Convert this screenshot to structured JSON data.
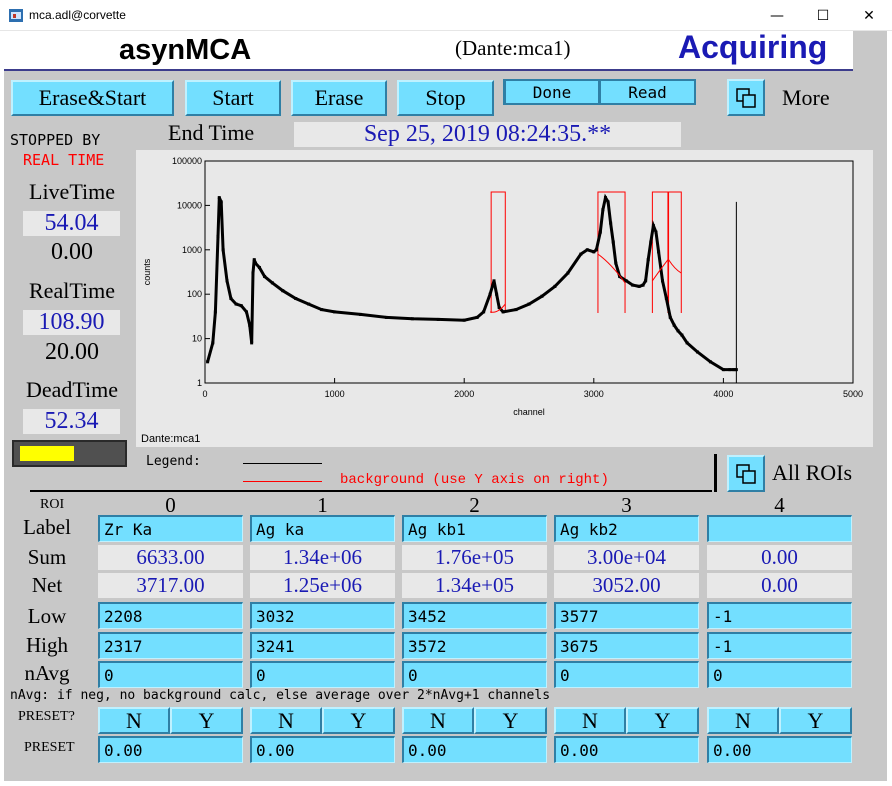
{
  "window": {
    "title": "mca.adl@corvette",
    "minimize": "—",
    "maximize": "☐",
    "close": "✕"
  },
  "header": {
    "app": "asynMCA",
    "device": "(Dante:mca1)",
    "status": "Acquiring"
  },
  "buttons": {
    "erase_start": "Erase&Start",
    "start": "Start",
    "erase": "Erase",
    "stop": "Stop",
    "more": "More",
    "all_rois": "All ROIs"
  },
  "indicators": {
    "done": "Done",
    "read": "Read"
  },
  "stopped": {
    "line1": "STOPPED BY",
    "line2": "REAL TIME"
  },
  "end_time": {
    "label": "End Time",
    "value": "Sep 25, 2019 08:24:35.**"
  },
  "live_time": {
    "label": "LiveTime",
    "value": "54.04",
    "preset": "0.00"
  },
  "real_time": {
    "label": "RealTime",
    "value": "108.90",
    "preset": "20.00"
  },
  "dead_time": {
    "label": "DeadTime",
    "value": "52.34",
    "bar_fraction": 0.5234
  },
  "colors": {
    "accent_button": "#73dfff",
    "status_blue": "#1a1ab4",
    "background_curve": "#ff0000",
    "dead_bar": "#ffff00"
  },
  "chart_data": {
    "type": "line",
    "xlabel": "channel",
    "ylabel": "counts",
    "xlim": [
      0,
      5000
    ],
    "ylim": [
      1,
      100000
    ],
    "yscale": "log",
    "x_ticks": [
      "0",
      "1000",
      "2000",
      "3000",
      "4000",
      "5000"
    ],
    "y_ticks": [
      "1",
      "10",
      "100",
      "1000",
      "10000",
      "100000"
    ],
    "footer": "Dante:mca1",
    "series": [
      {
        "name": "",
        "color": "#000000",
        "x": [
          20,
          60,
          80,
          100,
          110,
          125,
          140,
          170,
          200,
          240,
          280,
          320,
          345,
          360,
          370,
          380,
          390,
          420,
          460,
          520,
          600,
          700,
          800,
          900,
          1000,
          1200,
          1400,
          1600,
          1800,
          2000,
          2100,
          2150,
          2200,
          2230,
          2250,
          2270,
          2300,
          2400,
          2500,
          2600,
          2700,
          2800,
          2900,
          2950,
          3000,
          3020,
          3050,
          3070,
          3090,
          3110,
          3130,
          3150,
          3170,
          3200,
          3250,
          3300,
          3350,
          3380,
          3400,
          3420,
          3440,
          3460,
          3480,
          3500,
          3530,
          3560,
          3590,
          3620,
          3650,
          3680,
          3720,
          3800,
          3900,
          4000,
          4050,
          4080,
          4100
        ],
        "y": [
          3,
          8,
          40,
          2000,
          15000,
          12000,
          1000,
          200,
          80,
          60,
          55,
          40,
          20,
          8,
          300,
          600,
          500,
          400,
          250,
          180,
          120,
          80,
          60,
          45,
          40,
          35,
          30,
          28,
          27,
          26,
          30,
          40,
          100,
          200,
          100,
          50,
          40,
          45,
          60,
          90,
          150,
          300,
          800,
          1000,
          900,
          1000,
          2500,
          8000,
          15000,
          12000,
          4000,
          1500,
          500,
          250,
          200,
          160,
          150,
          160,
          200,
          600,
          1500,
          3500,
          2500,
          900,
          200,
          80,
          30,
          20,
          15,
          12,
          8,
          5,
          3,
          2,
          2,
          2,
          2
        ]
      },
      {
        "name": "background (use Y axis on right)",
        "color": "#ff0000",
        "x": [
          2200,
          2317,
          3032,
          3241,
          3452,
          3572,
          3577,
          3675
        ],
        "y": [
          40,
          60,
          800,
          180,
          200,
          600,
          600,
          300
        ]
      }
    ],
    "roi_markers": [
      2208,
      2317,
      3032,
      3241,
      3452,
      3572,
      3577,
      3675
    ],
    "legend": {
      "label": "Legend:",
      "entries": [
        "",
        "background (use Y axis on right)"
      ]
    }
  },
  "roi_table": {
    "header_label": "ROI",
    "row_labels": {
      "label": "Label",
      "sum": "Sum",
      "net": "Net",
      "low": "Low",
      "high": "High",
      "navg": "nAvg"
    },
    "columns": [
      {
        "index": "0",
        "label": "Zr Ka",
        "sum": "6633.00",
        "net": "3717.00",
        "low": "2208",
        "high": "2317",
        "navg": "0",
        "preset": "0.00"
      },
      {
        "index": "1",
        "label": "Ag ka",
        "sum": "1.34e+06",
        "net": "1.25e+06",
        "low": "3032",
        "high": "3241",
        "navg": "0",
        "preset": "0.00"
      },
      {
        "index": "2",
        "label": "Ag kb1",
        "sum": "1.76e+05",
        "net": "1.34e+05",
        "low": "3452",
        "high": "3572",
        "navg": "0",
        "preset": "0.00"
      },
      {
        "index": "3",
        "label": "Ag kb2",
        "sum": "3.00e+04",
        "net": "3052.00",
        "low": "3577",
        "high": "3675",
        "navg": "0",
        "preset": "0.00"
      },
      {
        "index": "4",
        "label": "",
        "sum": "0.00",
        "net": "0.00",
        "low": "-1",
        "high": "-1",
        "navg": "0",
        "preset": "0.00"
      }
    ],
    "navg_note": "nAvg: if neg, no background calc, else average over 2*nAvg+1 channels",
    "preset_label": "PRESET?",
    "preset_value_label": "PRESET",
    "preset_no": "N",
    "preset_yes": "Y"
  }
}
